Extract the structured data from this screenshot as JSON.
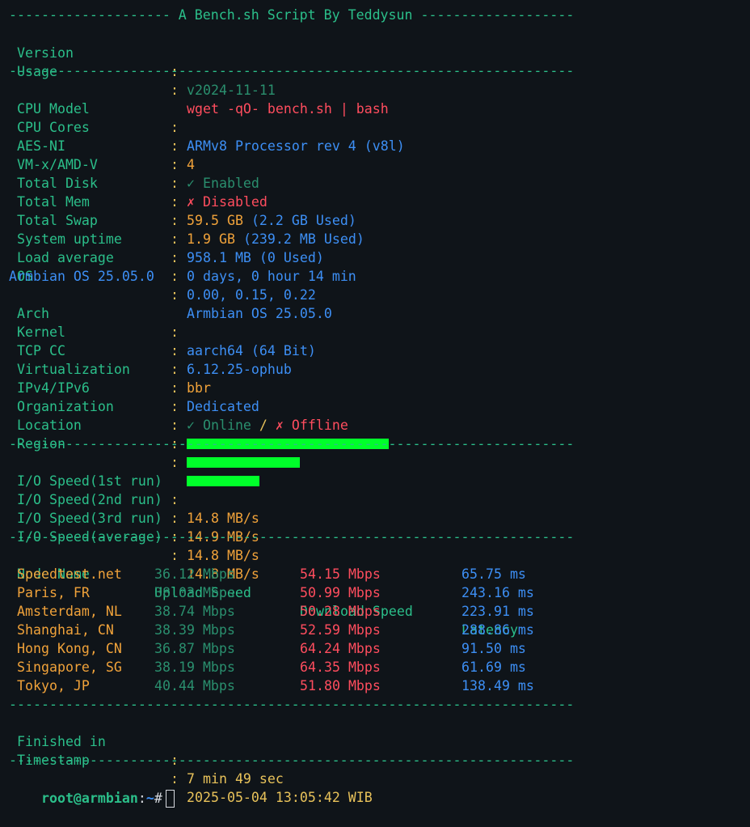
{
  "header": {
    "title": "-------------------- A Bench.sh Script By Teddysun -------------------"
  },
  "separator": "----------------------------------------------------------------------",
  "meta": [
    {
      "key": "Version",
      "value": "v2024-11-11"
    },
    {
      "key": "Usage",
      "value": "wget -qO- bench.sh | bash"
    }
  ],
  "system": {
    "cpu_model": {
      "key": "CPU Model",
      "value": "ARMv8 Processor rev 4 (v8l)"
    },
    "cpu_cores": {
      "key": "CPU Cores",
      "value": "4"
    },
    "aes": {
      "key": "AES-NI",
      "value": "✓ Enabled"
    },
    "vmx": {
      "key": "VM-x/AMD-V",
      "value": "✗ Disabled"
    },
    "disk": {
      "key": "Total Disk",
      "main": "59.5 GB",
      "used": "(2.2 GB Used)"
    },
    "mem": {
      "key": "Total Mem",
      "main": "1.9 GB",
      "used": "(239.2 MB Used)"
    },
    "swap": {
      "key": "Total Swap",
      "value": "958.1 MB (0 Used)"
    },
    "uptime": {
      "key": "System uptime",
      "value": "0 days, 0 hour 14 min"
    },
    "load": {
      "key": "Load average",
      "value": "0.00, 0.15, 0.22"
    },
    "os": {
      "key": "OS",
      "value": "Armbian OS 25.05.0",
      "wrap": "Armbian OS 25.05.0"
    },
    "arch": {
      "key": "Arch",
      "value": "aarch64 (64 Bit)"
    },
    "kernel": {
      "key": "Kernel",
      "value": "6.12.25-ophub"
    },
    "tcp": {
      "key": "TCP CC",
      "value": "bbr"
    },
    "virt": {
      "key": "Virtualization",
      "value": "Dedicated"
    },
    "ip": {
      "key": "IPv4/IPv6",
      "online": "✓ Online",
      "slash": " / ",
      "offline": "✗ Offline"
    },
    "org": {
      "key": "Organization"
    },
    "loc": {
      "key": "Location"
    },
    "region": {
      "key": "Region"
    }
  },
  "io": [
    {
      "key": "I/O Speed(1st run)",
      "value": "14.8 MB/s"
    },
    {
      "key": "I/O Speed(2nd run)",
      "value": "14.9 MB/s"
    },
    {
      "key": "I/O Speed(3rd run)",
      "value": "14.8 MB/s"
    },
    {
      "key": "I/O Speed(average)",
      "value": "14.8 MB/s"
    }
  ],
  "speed": {
    "headers": {
      "node": "Node Name",
      "upload": "Upload Speed",
      "download": "Download Speed",
      "latency": "Latency"
    },
    "rows": [
      {
        "node": "Speedtest.net",
        "upload": "36.12 Mbps",
        "download": "54.15 Mbps",
        "latency": "65.75 ms"
      },
      {
        "node": "Paris, FR",
        "upload": "38.03 Mbps",
        "download": "50.99 Mbps",
        "latency": "243.16 ms"
      },
      {
        "node": "Amsterdam, NL",
        "upload": "38.74 Mbps",
        "download": "50.28 Mbps",
        "latency": "223.91 ms"
      },
      {
        "node": "Shanghai, CN",
        "upload": "38.39 Mbps",
        "download": "52.59 Mbps",
        "latency": "288.86 ms"
      },
      {
        "node": "Hong Kong, CN",
        "upload": "36.87 Mbps",
        "download": "64.24 Mbps",
        "latency": "91.50 ms"
      },
      {
        "node": "Singapore, SG",
        "upload": "38.19 Mbps",
        "download": "64.35 Mbps",
        "latency": "61.69 ms"
      },
      {
        "node": "Tokyo, JP",
        "upload": "40.44 Mbps",
        "download": "51.80 Mbps",
        "latency": "138.49 ms"
      }
    ]
  },
  "footer": {
    "finished": {
      "key": "Finished in",
      "value": "7 min 49 sec"
    },
    "timestamp": {
      "key": "Timestamp",
      "value": "2025-05-04 13:05:42 WIB"
    }
  },
  "prompt": {
    "user": "root@armbian",
    "sep": ":",
    "path": "~",
    "symbol": "#"
  },
  "colon": ":",
  "colors": {
    "background": "#0f1419",
    "green": "#2bbf8a",
    "red": "#ff4d5e",
    "blue": "#3d8ff5",
    "orange": "#f0a23a",
    "redact": "#00ff2a"
  }
}
